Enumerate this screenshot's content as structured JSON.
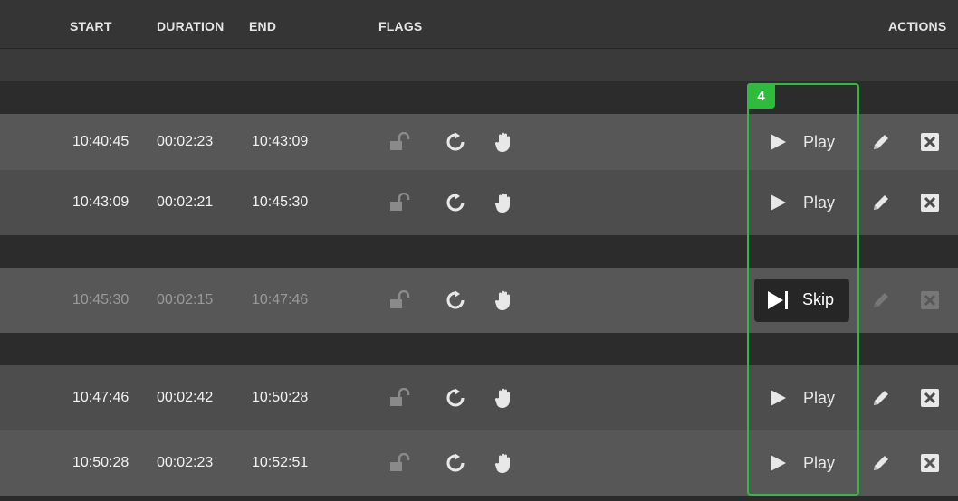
{
  "header": {
    "start": "START",
    "duration": "DURATION",
    "end": "END",
    "flags": "FLAGS",
    "actions": "ACTIONS"
  },
  "focus_badge": "4",
  "rows": [
    {
      "start": "10:40:45",
      "duration": "00:02:23",
      "end": "10:43:09",
      "action": "Play",
      "dimmed": false
    },
    {
      "start": "10:43:09",
      "duration": "00:02:21",
      "end": "10:45:30",
      "action": "Play",
      "dimmed": false
    },
    {
      "start": "10:45:30",
      "duration": "00:02:15",
      "end": "10:47:46",
      "action": "Skip",
      "dimmed": true
    },
    {
      "start": "10:47:46",
      "duration": "00:02:42",
      "end": "10:50:28",
      "action": "Play",
      "dimmed": false
    },
    {
      "start": "10:50:28",
      "duration": "00:02:23",
      "end": "10:52:51",
      "action": "Play",
      "dimmed": false
    }
  ],
  "icons": {
    "lock": "unlock-icon",
    "reload": "reload-icon",
    "hand": "hand-icon",
    "edit": "pencil-icon",
    "delete": "close-icon",
    "play": "play-icon",
    "skip": "skip-icon"
  },
  "colors": {
    "accent": "#2fbb3c"
  }
}
